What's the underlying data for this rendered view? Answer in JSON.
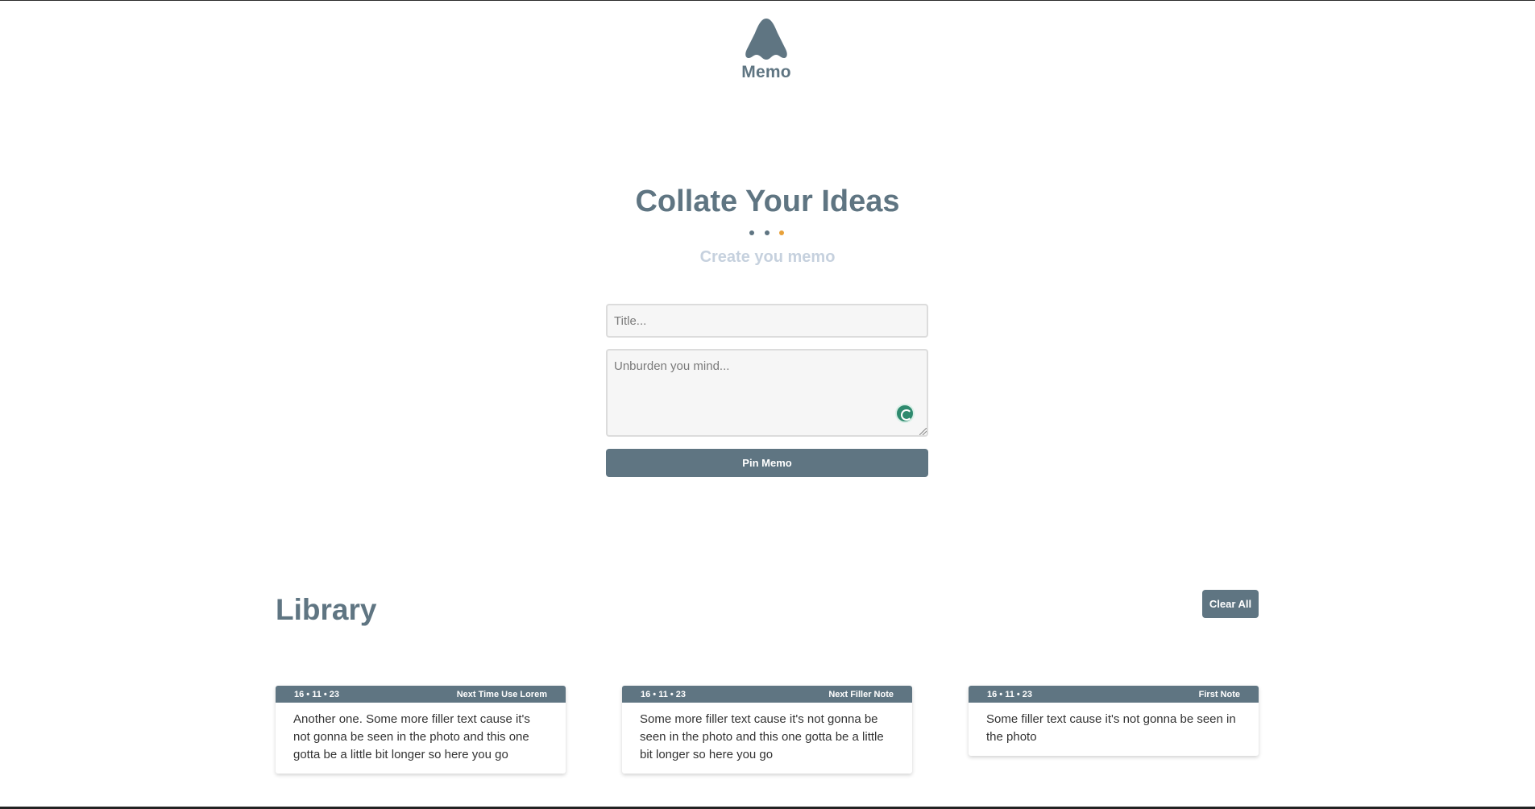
{
  "logo": {
    "text": "Memo"
  },
  "hero": {
    "title": "Collate Your Ideas",
    "subtitle": "Create you memo",
    "dot_colors": [
      "#5f7582",
      "#5f7582",
      "#e8a13a"
    ]
  },
  "form": {
    "title_placeholder": "Title...",
    "title_value": "",
    "body_placeholder": "Unburden you mind...",
    "body_value": "",
    "pin_label": "Pin Memo"
  },
  "library": {
    "title": "Library",
    "clear_label": "Clear All",
    "cards": [
      {
        "date": "16 • 11 • 23",
        "title": "Next Time Use Lorem",
        "body": "Another one. Some more filler text cause it's not gonna be seen in the photo and this one gotta be a little bit longer so here you go"
      },
      {
        "date": "16 • 11 • 23",
        "title": "Next Filler Note",
        "body": "Some more filler text cause it's not gonna be seen in the photo and this one gotta be a little bit longer so here you go"
      },
      {
        "date": "16 • 11 • 23",
        "title": "First Note",
        "body": "Some filler text cause it's not gonna be seen in the photo"
      }
    ]
  },
  "colors": {
    "accent": "#5f7582",
    "subtitle": "#c6d1de",
    "dot_highlight": "#e8a13a",
    "grammarly": "#2e8a6e"
  },
  "icons": {
    "logo": "memo-logo-icon",
    "grammarly": "grammarly-icon",
    "resize": "resize-grip-icon"
  }
}
